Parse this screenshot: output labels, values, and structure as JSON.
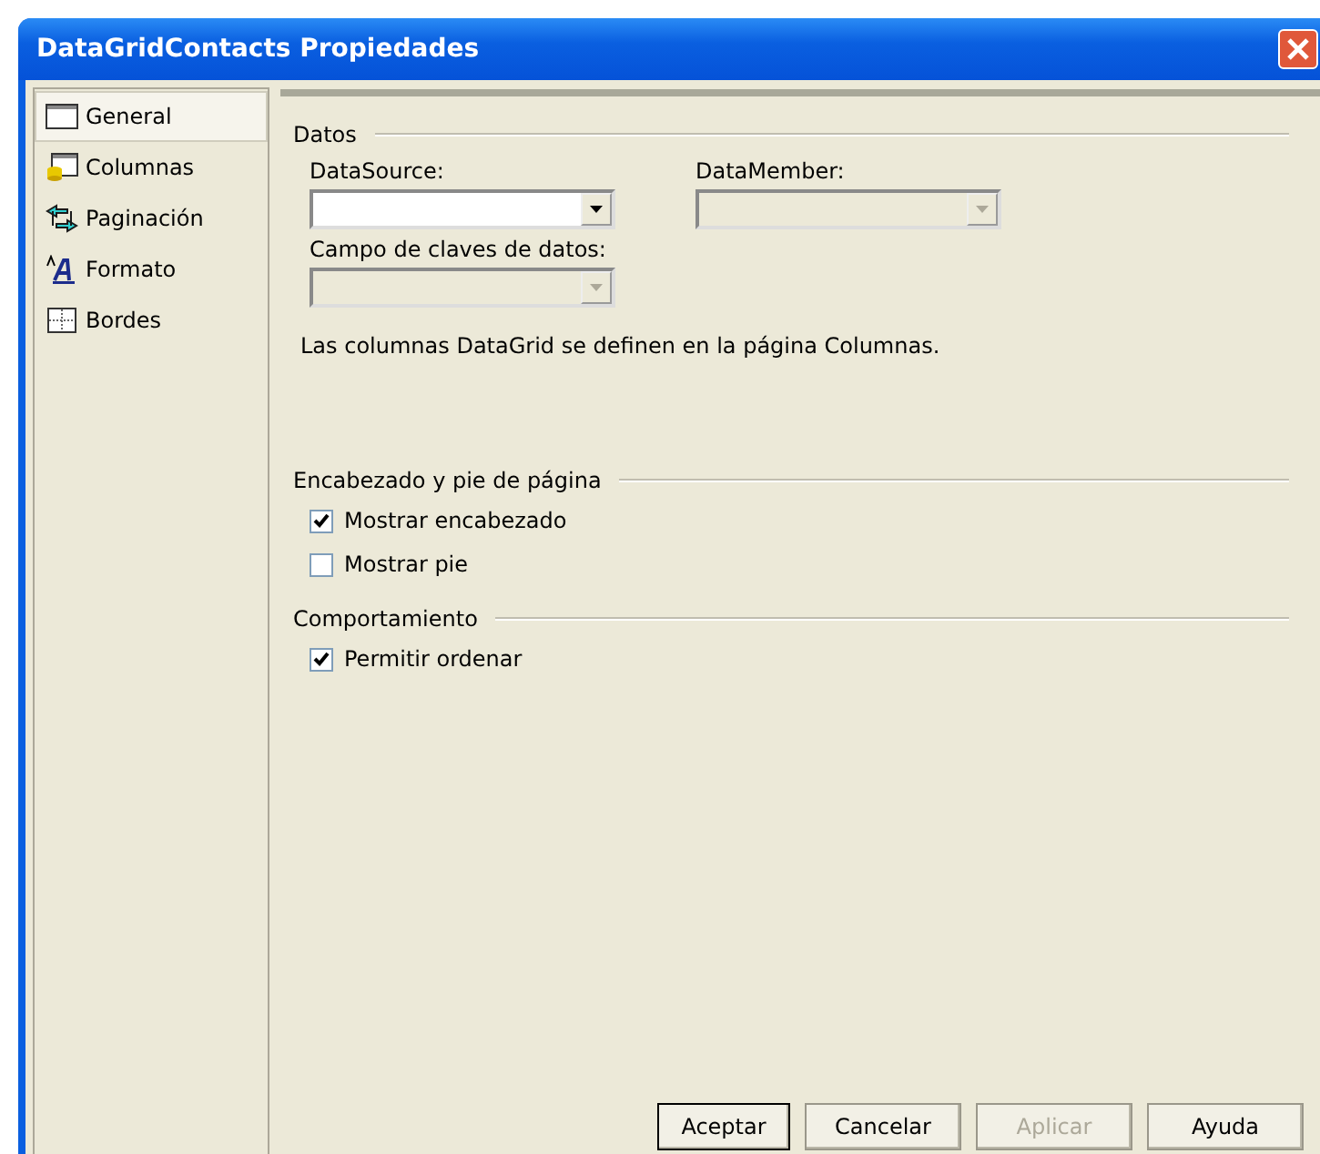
{
  "window": {
    "title": "DataGridContacts Propiedades"
  },
  "sidebar": {
    "items": [
      {
        "label": "General",
        "selected": true,
        "kind": "window"
      },
      {
        "label": "Columnas",
        "selected": false,
        "kind": "columns"
      },
      {
        "label": "Paginación",
        "selected": false,
        "kind": "paging"
      },
      {
        "label": "Formato",
        "selected": false,
        "kind": "format"
      },
      {
        "label": "Bordes",
        "selected": false,
        "kind": "borders"
      }
    ]
  },
  "datos": {
    "title": "Datos",
    "combos": [
      {
        "label": "DataSource:",
        "disabled": false
      },
      {
        "label": "DataMember:",
        "disabled": true
      },
      {
        "label": "Campo de claves de datos:",
        "disabled": true
      }
    ],
    "note": "Las columnas DataGrid se definen en la página Columnas."
  },
  "header_footer": {
    "title": "Encabezado y pie de página",
    "checkboxes": [
      {
        "label": "Mostrar encabezado",
        "checked": true
      },
      {
        "label": "Mostrar pie",
        "checked": false
      }
    ]
  },
  "behavior": {
    "title": "Comportamiento",
    "checkboxes": [
      {
        "label": "Permitir ordenar",
        "checked": true
      }
    ]
  },
  "buttons": [
    {
      "label": "Aceptar",
      "disabled": false,
      "default": true
    },
    {
      "label": "Cancelar",
      "disabled": false,
      "default": false
    },
    {
      "label": "Aplicar",
      "disabled": true,
      "default": false
    },
    {
      "label": "Ayuda",
      "disabled": false,
      "default": false
    }
  ]
}
